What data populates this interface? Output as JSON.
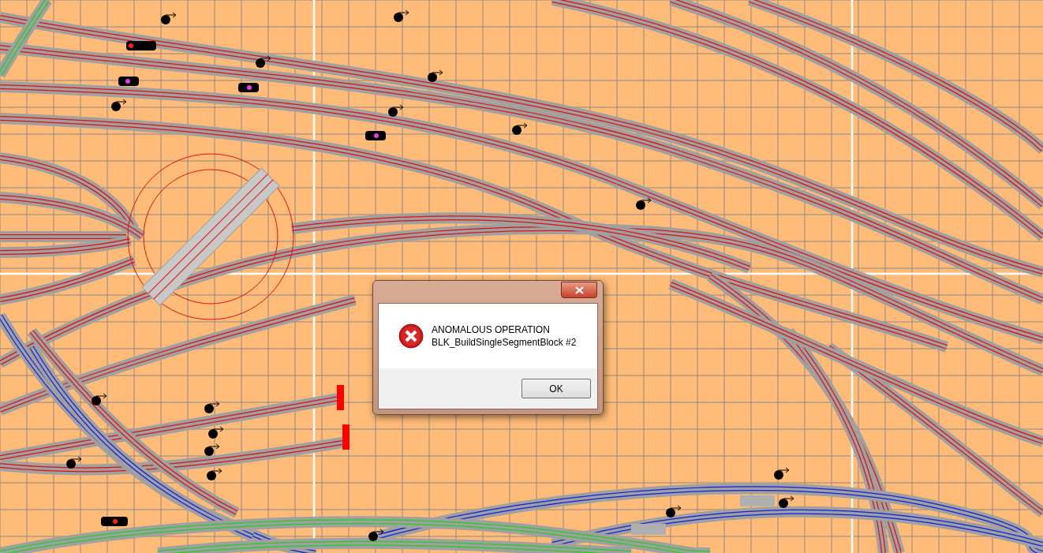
{
  "dialog": {
    "message_lines": [
      "ANOMALOUS OPERATION",
      "BLK_BuildSingleSegmentBlock #2"
    ],
    "buttons": [
      "OK"
    ]
  }
}
